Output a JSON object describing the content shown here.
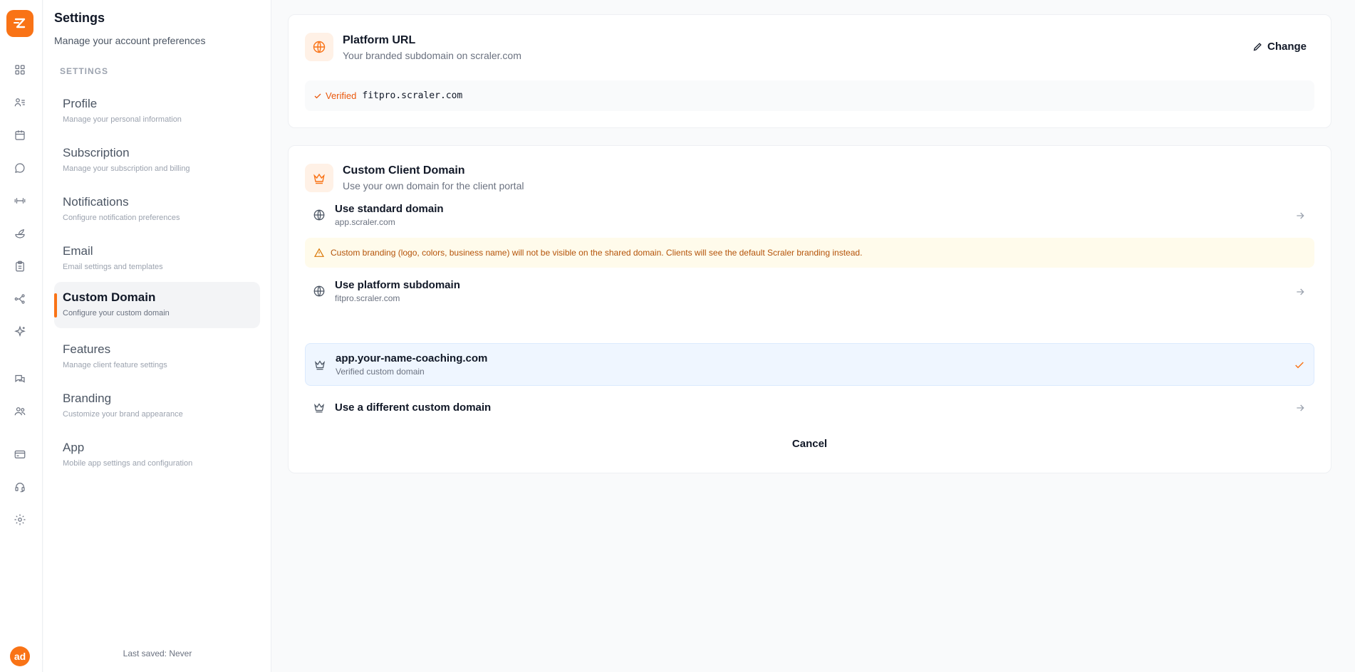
{
  "app": {
    "logo": "lightning-logo",
    "user_initials": "ad"
  },
  "rail_icons": [
    "dashboard-icon",
    "clients-icon",
    "calendar-icon",
    "chat-icon",
    "dumbbell-icon",
    "nutrition-icon",
    "clipboard-icon",
    "workflow-icon",
    "sparkle-icon",
    "community-icon",
    "team-icon",
    "billing-icon",
    "support-icon",
    "settings-icon"
  ],
  "sidebar": {
    "title": "Settings",
    "subtitle": "Manage your account preferences",
    "section_label": "SETTINGS",
    "items": [
      {
        "label": "Profile",
        "desc": "Manage your personal information"
      },
      {
        "label": "Subscription",
        "desc": "Manage your subscription and billing"
      },
      {
        "label": "Notifications",
        "desc": "Configure notification preferences"
      },
      {
        "label": "Email",
        "desc": "Email settings and templates"
      },
      {
        "label": "Custom Domain",
        "desc": "Configure your custom domain",
        "active": true
      },
      {
        "label": "Features",
        "desc": "Manage client feature settings"
      },
      {
        "label": "Branding",
        "desc": "Customize your brand appearance"
      },
      {
        "label": "App",
        "desc": "Mobile app settings and configuration"
      }
    ],
    "last_saved": "Last saved: Never"
  },
  "platform_url": {
    "title": "Platform URL",
    "subtitle": "Your branded subdomain on scraler.com",
    "change_label": "Change",
    "verified_label": "Verified",
    "domain": "fitpro.scraler.com"
  },
  "custom_domain": {
    "title": "Custom Client Domain",
    "subtitle": "Use your own domain for the client portal",
    "options": [
      {
        "title": "Use standard domain",
        "sub": "app.scraler.com",
        "icon": "globe-icon"
      },
      {
        "title": "Use platform subdomain",
        "sub": "fitpro.scraler.com",
        "icon": "globe-icon"
      },
      {
        "title": "app.your-name-coaching.com",
        "sub": "Verified custom domain",
        "icon": "crown-icon",
        "selected": true
      },
      {
        "title": "Use a different custom domain",
        "icon": "crown-icon"
      }
    ],
    "warning": "Custom branding (logo, colors, business name) will not be visible on the shared domain. Clients will see the default Scraler branding instead.",
    "cancel_label": "Cancel"
  },
  "colors": {
    "accent": "#f97316",
    "warning_bg": "#fffbeb",
    "selected_bg": "#eff6ff"
  }
}
